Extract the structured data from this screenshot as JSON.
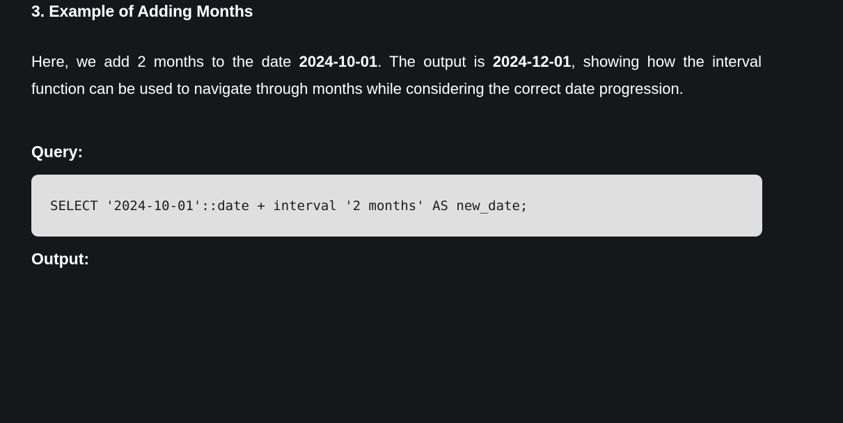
{
  "section": {
    "heading": "3. Example of Adding Months"
  },
  "paragraph": {
    "part1": "Here, we add 2 months to the date ",
    "date_in": "2024-10-01",
    "part2": ". The output is ",
    "date_out": "2024-12-01",
    "part3": ", showing how the interval function can be used to navigate through months while considering the correct date progression."
  },
  "query": {
    "label": "Query:",
    "code": "SELECT '2024-10-01'::date + interval '2 months' AS new_date;"
  },
  "output": {
    "label": "Output:"
  },
  "colors": {
    "background": "#15171b",
    "text": "#ffffff",
    "code_background": "#dfdfdf",
    "code_text": "#1b1b1b"
  }
}
